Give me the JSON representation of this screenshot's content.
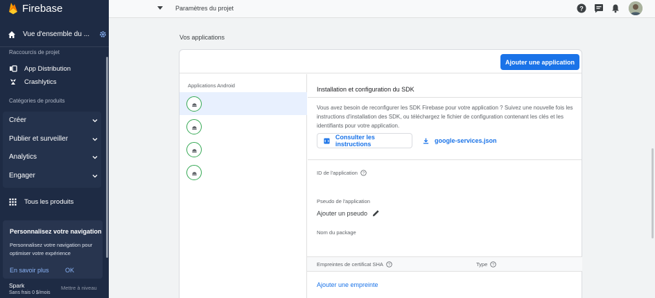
{
  "sidebar": {
    "brand": "Firebase",
    "overview_label": "Vue d'ensemble du ...",
    "shortcuts_label": "Raccourcis de projet",
    "shortcuts": [
      {
        "label": "App Distribution",
        "icon": "app-distribution-icon"
      },
      {
        "label": "Crashlytics",
        "icon": "crashlytics-icon"
      }
    ],
    "categories_label": "Catégories de produits",
    "categories": [
      {
        "label": "Créer"
      },
      {
        "label": "Publier et surveiller"
      },
      {
        "label": "Analytics"
      },
      {
        "label": "Engager"
      }
    ],
    "all_products": "Tous les produits",
    "promo": {
      "title": "Personnalisez votre navigation",
      "description": "Personnalisez votre navigation pour optimiser votre expérience",
      "learn_more": "En savoir plus",
      "ok": "OK"
    },
    "plan": {
      "name": "Spark",
      "subtitle": "Sans frais 0 $/mois",
      "upgrade": "Mettre à niveau"
    }
  },
  "topbar": {
    "title": "Paramètres du projet"
  },
  "main": {
    "section_title": "Vos applications",
    "add_app_button": "Ajouter une application",
    "apps_header": "Applications Android",
    "app_count": 4,
    "sdk": {
      "title": "Installation et configuration du SDK",
      "description": "Vous avez besoin de reconfigurer les SDK Firebase pour votre application ? Suivez une nouvelle fois les instructions d'installation des SDK, ou téléchargez le fichier de configuration contenant les clés et les identifiants pour votre application.",
      "instructions_button": "Consulter les instructions",
      "json_button": "google-services.json"
    },
    "fields": {
      "app_id_label": "ID de l'application",
      "nickname_label": "Pseudo de l'application",
      "nickname_value": "Ajouter un pseudo",
      "package_label": "Nom du package"
    },
    "sha": {
      "label": "Empreintes de certificat SHA",
      "type_label": "Type",
      "add_link": "Ajouter une empreinte"
    }
  },
  "colors": {
    "sidebar_bg": "#1e2b44",
    "primary": "#1a73e8",
    "android_green": "#34a853"
  }
}
